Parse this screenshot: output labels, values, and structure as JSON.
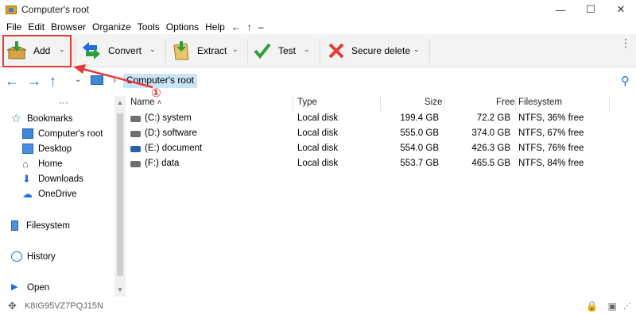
{
  "window": {
    "title": "Computer's root",
    "controls": {
      "minimize": "—",
      "maximize": "☐",
      "close": "✕"
    }
  },
  "menu": {
    "items": [
      "File",
      "Edit",
      "Browser",
      "Organize",
      "Tools",
      "Options",
      "Help",
      "←",
      "↑",
      "–"
    ]
  },
  "toolbar": {
    "buttons": [
      {
        "label": "Add",
        "icon": "add-archive-icon"
      },
      {
        "label": "Convert",
        "icon": "convert-icon"
      },
      {
        "label": "Extract",
        "icon": "extract-icon"
      },
      {
        "label": "Test",
        "icon": "test-check-icon"
      },
      {
        "label": "Secure delete",
        "icon": "secure-delete-x-icon"
      }
    ],
    "dropdown_glyph": "⌄",
    "more_glyph": "⋮"
  },
  "address": {
    "back_icon": "←",
    "forward_icon": "→",
    "up_icon": "↑",
    "history_chevron": "⌄",
    "separator": "›",
    "crumb": "Computer's root",
    "search_icon": "⚲"
  },
  "sidebar": {
    "more": "···",
    "items": [
      {
        "label": "Bookmarks",
        "icon": "star-icon"
      },
      {
        "label": "Computer's root",
        "icon": "computer-icon"
      },
      {
        "label": "Desktop",
        "icon": "desktop-icon"
      },
      {
        "label": "Home",
        "icon": "home-icon"
      },
      {
        "label": "Downloads",
        "icon": "download-icon"
      },
      {
        "label": "OneDrive",
        "icon": "cloud-icon"
      },
      {
        "label": "Filesystem",
        "icon": "filesystem-icon"
      },
      {
        "label": "History",
        "icon": "clock-icon"
      },
      {
        "label": "Open",
        "icon": "play-icon"
      }
    ]
  },
  "filelist": {
    "columns": {
      "name": "Name",
      "type": "Type",
      "size": "Size",
      "free": "Free",
      "filesystem": "Filesystem"
    },
    "rows": [
      {
        "name": "(C:) system",
        "type": "Local disk",
        "size": "199.4 GB",
        "free": "72.2 GB",
        "fs": "NTFS, 36% free"
      },
      {
        "name": "(D:) software",
        "type": "Local disk",
        "size": "555.0 GB",
        "free": "374.0 GB",
        "fs": "NTFS, 67% free"
      },
      {
        "name": "(E:) document",
        "type": "Local disk",
        "size": "554.0 GB",
        "free": "426.3 GB",
        "fs": "NTFS, 76% free"
      },
      {
        "name": "(F:) data",
        "type": "Local disk",
        "size": "553.7 GB",
        "free": "465.5 GB",
        "fs": "NTFS, 84% free"
      }
    ]
  },
  "status": {
    "id": "K8IG95VZ7PQJ15N"
  },
  "annotation": {
    "number": "①"
  },
  "colors": {
    "accent": "#1e6fd9",
    "highlight": "#e53935",
    "selection": "#cce4f7"
  }
}
